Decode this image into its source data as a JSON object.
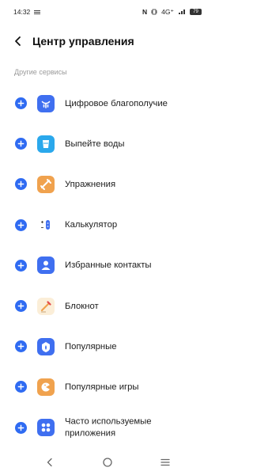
{
  "status_bar": {
    "time": "14:32",
    "network": "4G⁺",
    "battery": "79"
  },
  "header": {
    "title": "Центр управления"
  },
  "section": {
    "label": "Другие сервисы"
  },
  "items": [
    {
      "label": "Цифровое благополучие",
      "icon": "digital-wellbeing-icon",
      "color": "#3f6ff0"
    },
    {
      "label": "Выпейте воды",
      "icon": "water-glass-icon",
      "color": "#2aa8ec"
    },
    {
      "label": "Упражнения",
      "icon": "exercise-icon",
      "color": "#f0a24e"
    },
    {
      "label": "Калькулятор",
      "icon": "calculator-icon",
      "color": "#ffffff"
    },
    {
      "label": "Избранные контакты",
      "icon": "contacts-icon",
      "color": "#3f6ff0"
    },
    {
      "label": "Блокнот",
      "icon": "notepad-icon",
      "color": "#fbeed8"
    },
    {
      "label": "Популярные",
      "icon": "popular-icon",
      "color": "#3f6ff0"
    },
    {
      "label": "Популярные игры",
      "icon": "games-icon",
      "color": "#f0a24e"
    },
    {
      "label": "Часто используемые приложения",
      "icon": "frequent-apps-icon",
      "color": "#3f6ff0"
    }
  ],
  "accent_color": "#2f6bf2"
}
